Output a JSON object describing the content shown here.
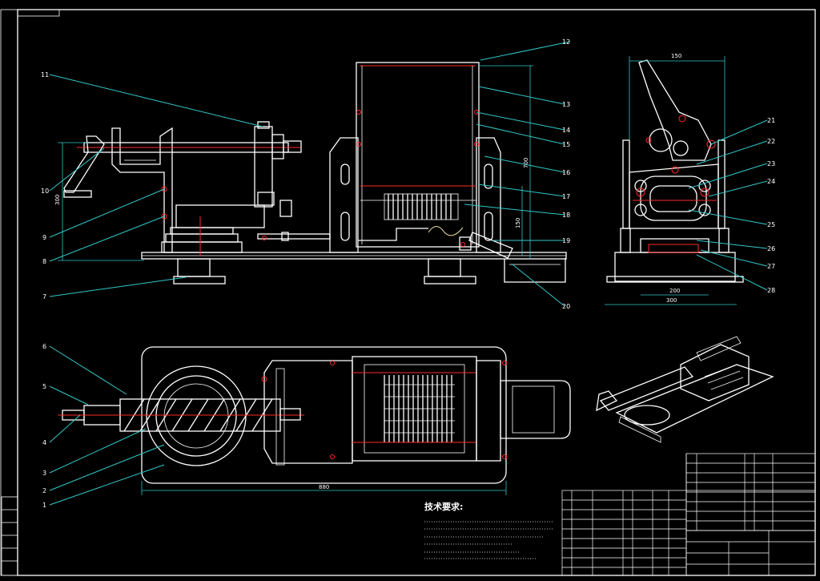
{
  "balloons": [
    "1",
    "2",
    "3",
    "4",
    "5",
    "6",
    "7",
    "8",
    "9",
    "10",
    "11",
    "12",
    "13",
    "14",
    "15",
    "16",
    "17",
    "18",
    "19",
    "20",
    "21",
    "22",
    "23",
    "24",
    "25",
    "26",
    "27",
    "28"
  ],
  "dimensions": {
    "front_height": "300",
    "right_width_top": "150",
    "right_width_mid": "200",
    "right_width_bottom": "300",
    "hopper_height": "700",
    "hopper_lower": "150",
    "plan_length": "880"
  },
  "tech_requirements": {
    "title": "技术要求:"
  }
}
